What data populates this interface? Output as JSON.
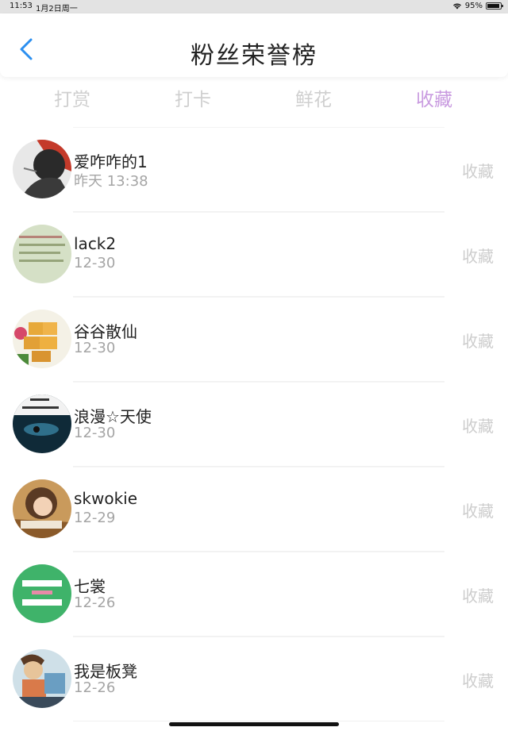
{
  "status": {
    "time": "11:53",
    "date": "1月2日周一",
    "battery": "95%",
    "battery_level": 0.95
  },
  "nav": {
    "title": "粉丝荣誉榜",
    "back_icon": "chevron-left-icon",
    "accent": "#2b8ff0"
  },
  "tabs": [
    {
      "label": "打赏",
      "active": false
    },
    {
      "label": "打卡",
      "active": false
    },
    {
      "label": "鲜花",
      "active": false
    },
    {
      "label": "收藏",
      "active": true
    }
  ],
  "active_tab_color": "#c99be0",
  "fans": [
    {
      "name": "爱咋咋的1",
      "date": "昨天 13:38",
      "action": "收藏"
    },
    {
      "name": "lack2",
      "date": "12-30",
      "action": "收藏"
    },
    {
      "name": "谷谷散仙",
      "date": "12-30",
      "action": "收藏"
    },
    {
      "name": "浪漫☆天使",
      "date": "12-30",
      "action": "收藏"
    },
    {
      "name": "skwokie",
      "date": "12-29",
      "action": "收藏"
    },
    {
      "name": "七裳",
      "date": "12-26",
      "action": "收藏"
    },
    {
      "name": "我是板凳",
      "date": "12-26",
      "action": "收藏"
    }
  ]
}
